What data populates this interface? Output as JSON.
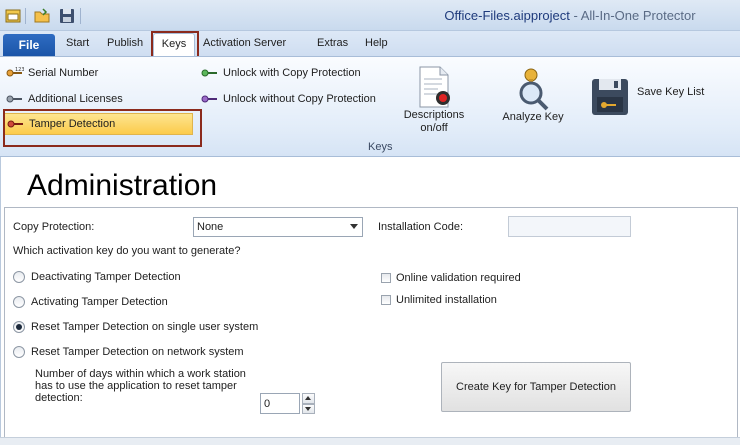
{
  "window": {
    "file_name": "Office-Files.aipproject",
    "separator": " - ",
    "app_name": "All-In-One Protector"
  },
  "tabs": {
    "file": "File",
    "start": "Start",
    "publish": "Publish",
    "keys": "Keys",
    "activation_server": "Activation Server",
    "extras": "Extras",
    "help": "Help"
  },
  "ribbon": {
    "serial_number": "Serial Number",
    "additional_licenses": "Additional Licenses",
    "tamper_detection": "Tamper Detection",
    "unlock_with_copy": "Unlock with Copy Protection",
    "unlock_without_copy": "Unlock without Copy Protection",
    "descriptions_line1": "Descriptions",
    "descriptions_line2": "on/off",
    "analyze_key": "Analyze Key",
    "save_key_list": "Save Key List",
    "group_label": "Keys"
  },
  "colors": {
    "accent": "#1b55a8",
    "highlight_box": "#8b2a1c",
    "selected_bg": "#fccb4b"
  },
  "main": {
    "title": "Administration",
    "copy_protection_label": "Copy Protection:",
    "copy_protection_value": "None",
    "installation_code_label": "Installation Code:",
    "question": "Which activation key do you want to generate?",
    "radios": [
      {
        "label": "Deactivating Tamper Detection",
        "checked": false
      },
      {
        "label": "Activating Tamper Detection",
        "checked": false
      },
      {
        "label": "Reset Tamper Detection on single user system",
        "checked": true
      },
      {
        "label": "Reset Tamper Detection on network system",
        "checked": false
      }
    ],
    "checkboxes": [
      {
        "label": "Online validation required",
        "checked": false
      },
      {
        "label": "Unlimited installation",
        "checked": false
      }
    ],
    "days_text": "Number of days within which a work station has to use the application to reset tamper detection:",
    "days_value": "0",
    "create_button": "Create Key for Tamper Detection"
  }
}
